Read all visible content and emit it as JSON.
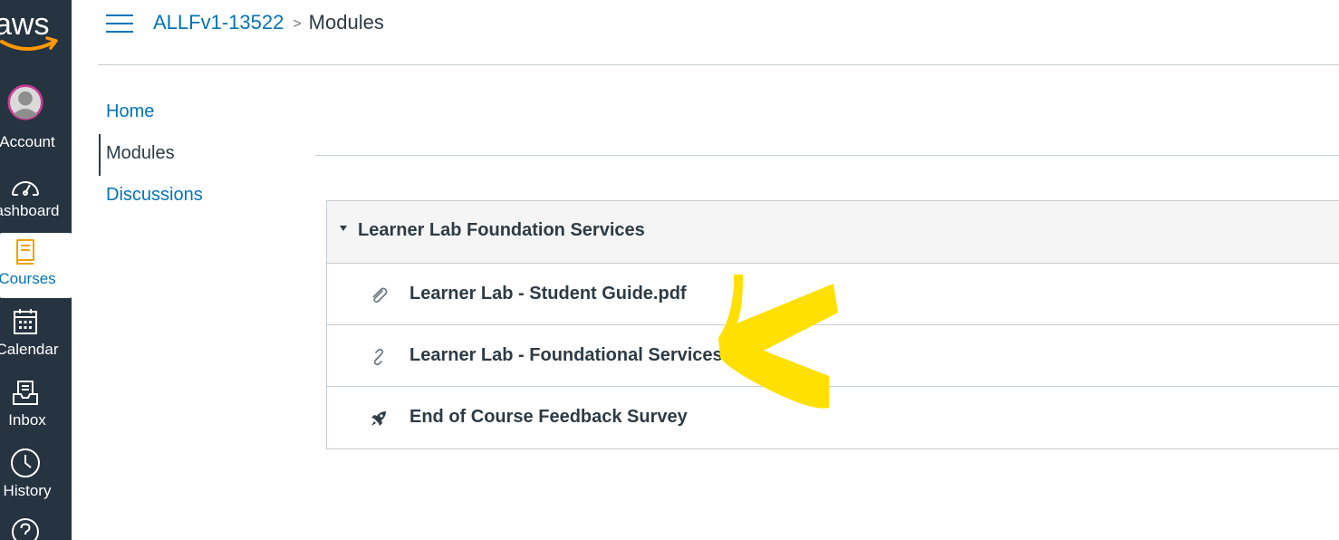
{
  "global_nav": {
    "logo_text": "aws",
    "items": [
      {
        "label": "Account",
        "icon": "account-avatar-icon"
      },
      {
        "label": "ashboard",
        "icon": "dashboard-icon"
      },
      {
        "label": "Courses",
        "icon": "courses-icon",
        "active": true
      },
      {
        "label": "Calendar",
        "icon": "calendar-icon"
      },
      {
        "label": "Inbox",
        "icon": "inbox-icon"
      },
      {
        "label": "History",
        "icon": "history-icon"
      },
      {
        "label": "",
        "icon": "help-icon"
      }
    ]
  },
  "header": {
    "breadcrumb": {
      "course": "ALLFv1-13522",
      "separator": ">",
      "current": "Modules"
    }
  },
  "course_nav": {
    "items": [
      {
        "label": "Home"
      },
      {
        "label": "Modules",
        "active": true
      },
      {
        "label": "Discussions"
      }
    ]
  },
  "module": {
    "title": "Learner Lab Foundation Services",
    "items": [
      {
        "title": "Learner Lab - Student Guide.pdf",
        "icon": "attachment-icon"
      },
      {
        "title": "Learner Lab - Foundational Services",
        "icon": "link-icon"
      },
      {
        "title": "End of Course Feedback Survey",
        "icon": "rocket-icon"
      }
    ]
  },
  "colors": {
    "nav_bg": "#263340",
    "link": "#0374b5",
    "text": "#2d3b45",
    "annotation_arrow": "#ffe000"
  }
}
